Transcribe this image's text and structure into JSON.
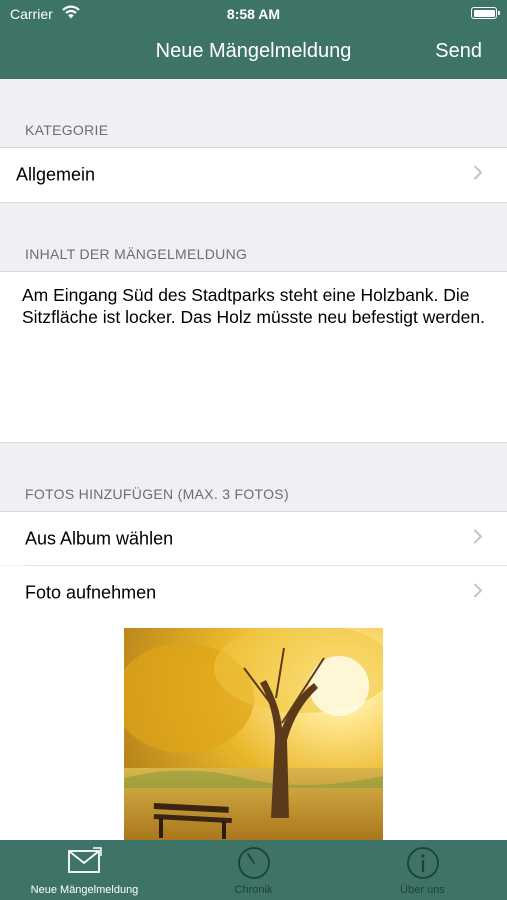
{
  "status_bar": {
    "carrier": "Carrier",
    "time": "8:58 AM"
  },
  "nav": {
    "title": "Neue Mängelmeldung",
    "send_label": "Send"
  },
  "category": {
    "header": "KATEGORIE",
    "value": "Allgemein"
  },
  "content": {
    "header": "INHALT DER MÄNGELMELDUNG",
    "text": "Am Eingang Süd des Stadtparks steht eine Holzbank. Die Sitzfläche ist locker. Das Holz müsste neu befestigt werden."
  },
  "photos": {
    "header": "FOTOS HINZUFÜGEN (MAX. 3 FOTOS)",
    "album_label": "Aus Album wählen",
    "camera_label": "Foto aufnehmen"
  },
  "tabs": [
    {
      "label": "Neue Mängelmeldung",
      "icon": "envelope-icon",
      "active": true
    },
    {
      "label": "Chronik",
      "icon": "clock-icon",
      "active": false
    },
    {
      "label": "Über uns",
      "icon": "info-icon",
      "active": false
    }
  ],
  "colors": {
    "brand": "#3e7367",
    "background": "#efeff4",
    "tab_inactive": "#1f3f37"
  }
}
